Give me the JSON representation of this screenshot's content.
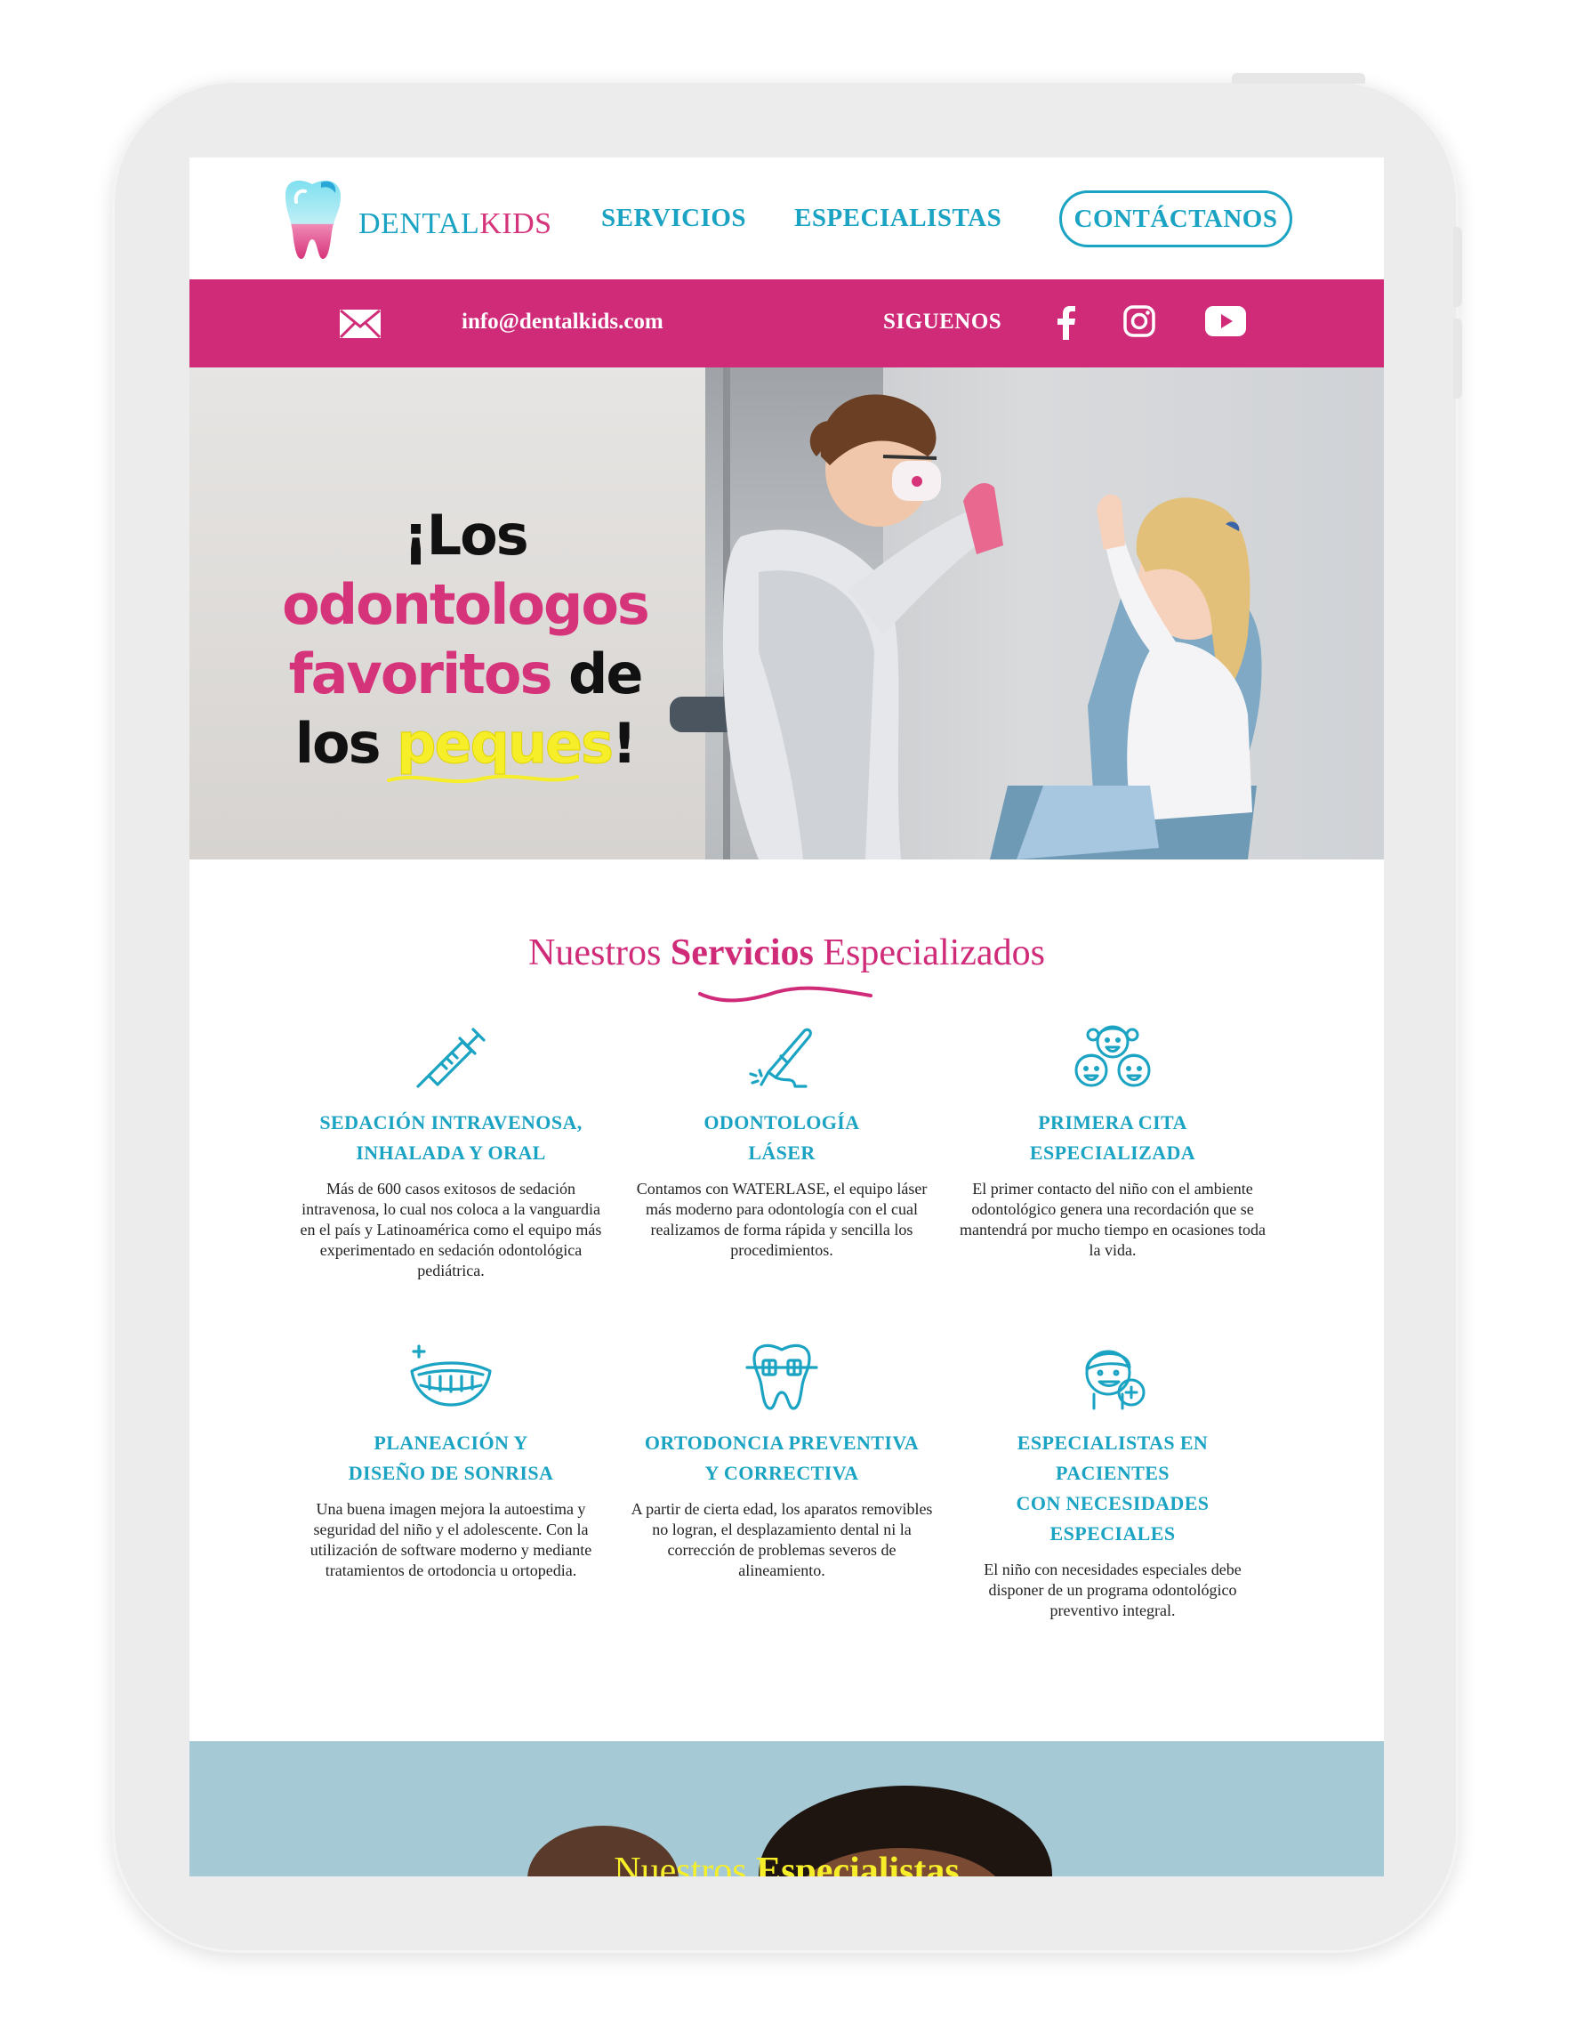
{
  "brand": {
    "name_part1": "DENTAL",
    "name_part2": "KIDS"
  },
  "nav": {
    "servicios": "SERVICIOS",
    "especialistas": "ESPECIALISTAS",
    "contactanos": "CONTÁCTANOS"
  },
  "infobar": {
    "email": "info@dentalkids.com",
    "follow": "SIGUENOS"
  },
  "hero": {
    "line1": "¡Los",
    "line2": "odontologos",
    "line3a": "favoritos",
    "line3b": " de",
    "line4a": "los ",
    "line4b": "peques",
    "line4c": "!"
  },
  "services": {
    "title_pre": "Nuestros ",
    "title_bold": "Servicios",
    "title_post": " Especializados",
    "items": [
      {
        "title1": "SEDACIÓN INTRAVENOSA,",
        "title2": "INHALADA Y ORAL",
        "desc": "Más de 600 casos exitosos de sedación intravenosa, lo cual nos coloca a la vanguardia en el país y Latinoamérica como el equipo más experimentado en sedación odontológica pediátrica.",
        "icon": "syringe-icon"
      },
      {
        "title1": "ODONTOLOGÍA",
        "title2": "LÁSER",
        "desc": "Contamos con WATERLASE, el equipo láser más moderno para odontología con el cual realizamos de forma rápida y sencilla los procedimientos.",
        "icon": "laser-pen-icon"
      },
      {
        "title1": "PRIMERA CITA",
        "title2": "ESPECIALIZADA",
        "desc": "El primer contacto del niño con el ambiente odontológico genera una recordación que se mantendrá por mucho tiempo en ocasiones toda la vida.",
        "icon": "kids-faces-icon"
      },
      {
        "title1": "PLANEACIÓN Y",
        "title2": "DISEÑO DE SONRISA",
        "desc": "Una buena imagen mejora la autoestima y seguridad del niño y el adolescente. Con la utilización de software moderno y mediante tratamientos de ortodoncia u ortopedia.",
        "icon": "smile-icon"
      },
      {
        "title1": "ORTODONCIA PREVENTIVA",
        "title2": "Y CORRECTIVA",
        "desc": "A partir de cierta edad, los aparatos removibles no logran, el desplazamiento dental ni la corrección de problemas severos de alineamiento.",
        "icon": "tooth-braces-icon"
      },
      {
        "title1": "ESPECIALISTAS EN",
        "title2": "PACIENTES",
        "title3": "CON NECESIDADES",
        "title4": "ESPECIALES",
        "desc": "El niño con necesidades especiales debe disponer de un programa odontológico preventivo integral.",
        "icon": "special-needs-kid-icon"
      }
    ]
  },
  "specialists": {
    "title_pre": "Nuestros ",
    "title_bold": "Especialistas"
  },
  "colors": {
    "teal": "#1aa3c2",
    "pink": "#cf2b78",
    "yellow": "#f7ee2a"
  }
}
